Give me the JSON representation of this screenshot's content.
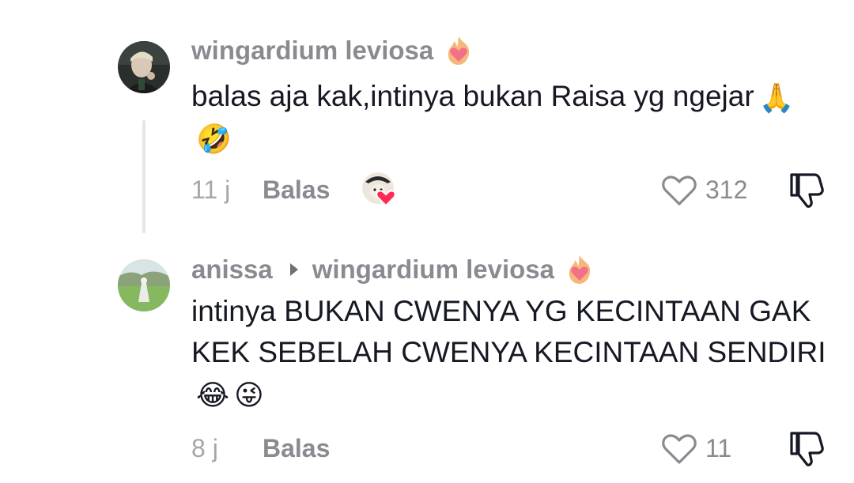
{
  "comments": [
    {
      "username": "wingardium leviosa",
      "creator_badge_icon": "heart-on-fire-icon",
      "text": "balas aja kak,intinya bukan Raisa yg ngejar",
      "emojis": [
        "🙏",
        "🤣"
      ],
      "time": "11 j",
      "reply_label": "Balas",
      "liked_by_creator_icon": "creator-avatar-heart-icon",
      "like_count": "312"
    },
    {
      "username": "anissa",
      "reply_to": "wingardium leviosa",
      "reply_to_badge_icon": "heart-on-fire-icon",
      "text": "intinya BUKAN CWENYA YG KECINTAAN GAK KEK SEBELAH CWENYA KECINTAAN SENDIRI",
      "emojis": [
        "😂",
        "😜"
      ],
      "time": "8 j",
      "reply_label": "Balas",
      "like_count": "11"
    }
  ],
  "colors": {
    "text_primary": "#161823",
    "username": "#8a8b91",
    "meta": "#a5a6ab",
    "thread_line": "#e6e6e8",
    "badge_heart": "#fe2c55"
  }
}
